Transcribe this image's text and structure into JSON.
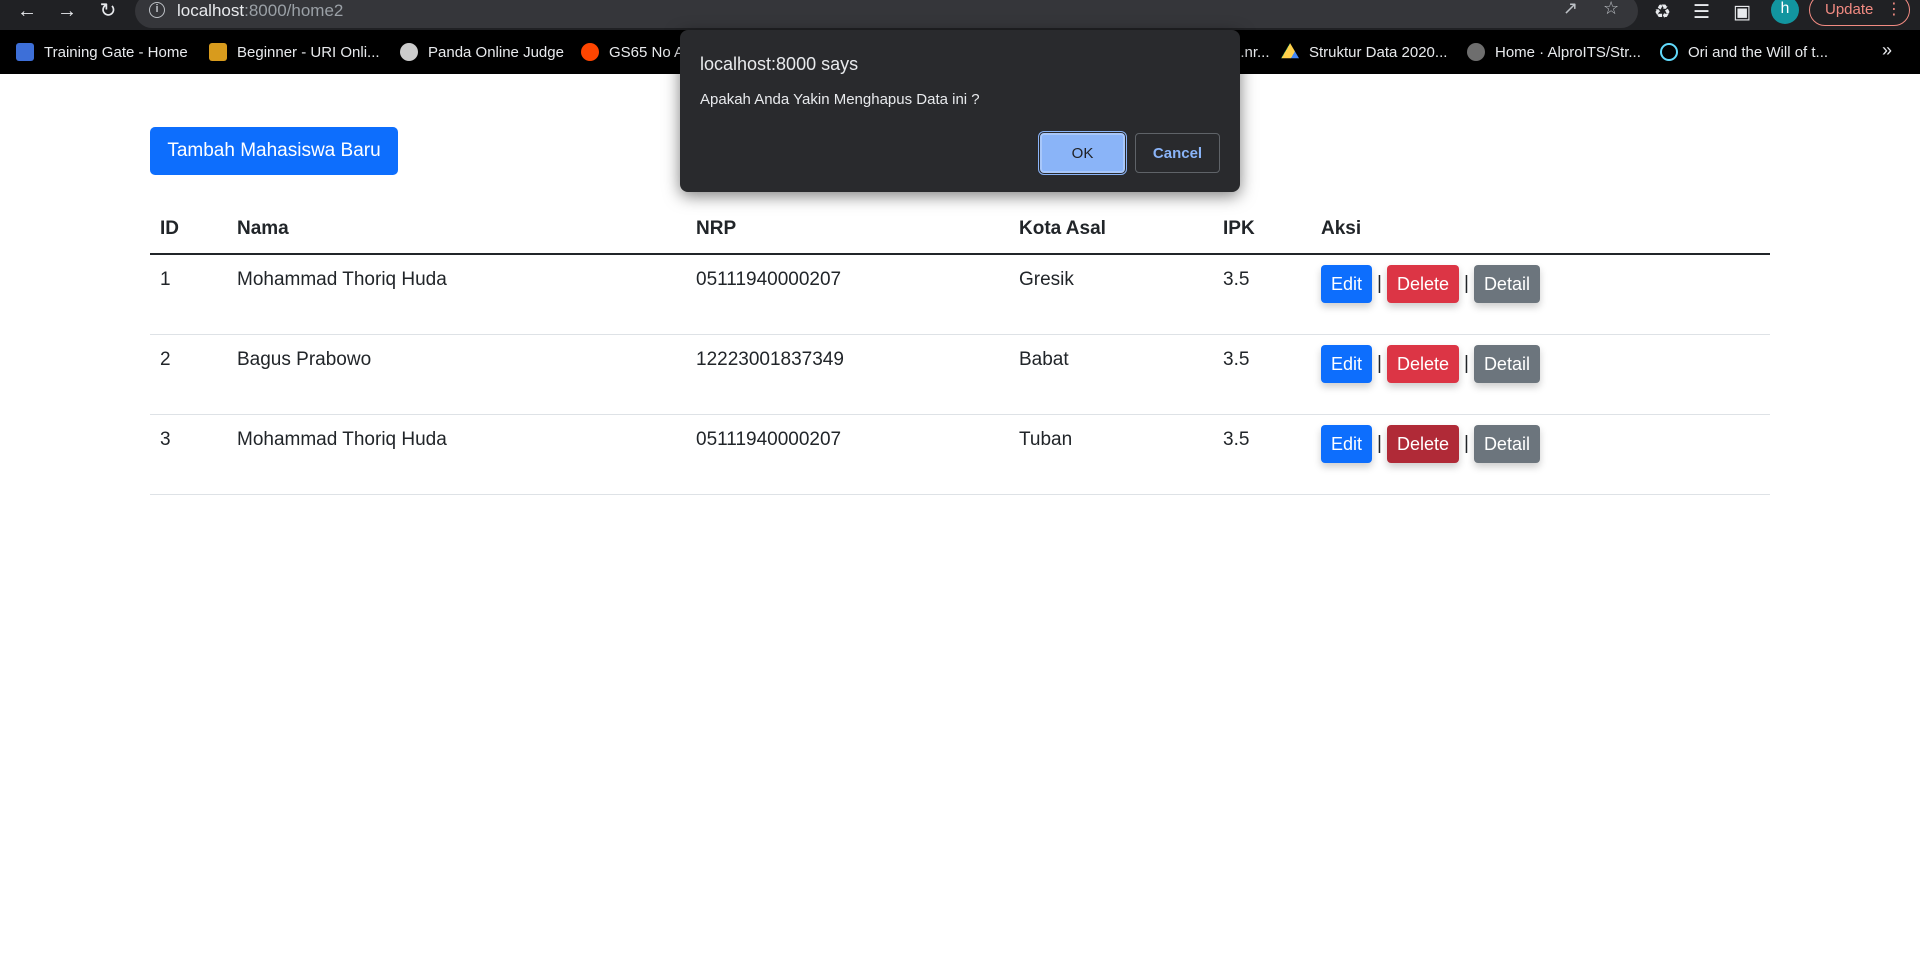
{
  "browser": {
    "url_host": "localhost",
    "url_path": ":8000/home2",
    "update_label": "Update",
    "avatar_letter": "h",
    "bookmarks": [
      {
        "label": "Training Gate - Home",
        "icon": "training-gate-icon",
        "color": "#3d6fd8"
      },
      {
        "label": "Beginner - URI Onli...",
        "icon": "trophy-icon",
        "color": "#d89b1d"
      },
      {
        "label": "Panda Online Judge",
        "icon": "panda-icon",
        "color": "#cccccc"
      },
      {
        "label": "GS65 No A",
        "icon": "reddit-icon",
        "color": "#ff4500"
      },
      {
        "label": "...nr...",
        "icon": "generic-icon",
        "color": "#555555"
      },
      {
        "label": "Struktur Data 2020...",
        "icon": "google-drive-icon",
        "color": "#1fa463"
      },
      {
        "label": "Home · AlproITS/Str...",
        "icon": "github-icon",
        "color": "#6e6e6e"
      },
      {
        "label": "Ori and the Will of t...",
        "icon": "react-icon",
        "color": "#61dafb"
      }
    ],
    "more_label": "»"
  },
  "page": {
    "add_button_label": "Tambah Mahasiswa Baru",
    "table": {
      "headers": [
        "ID",
        "Nama",
        "NRP",
        "Kota Asal",
        "IPK",
        "Aksi"
      ],
      "rows": [
        {
          "id": "1",
          "nama": "Mohammad Thoriq Huda",
          "nrp": "05111940000207",
          "kota": "Gresik",
          "ipk": "3.5"
        },
        {
          "id": "2",
          "nama": "Bagus Prabowo",
          "nrp": "12223001837349",
          "kota": "Babat",
          "ipk": "3.5"
        },
        {
          "id": "3",
          "nama": "Mohammad Thoriq Huda",
          "nrp": "05111940000207",
          "kota": "Tuban",
          "ipk": "3.5"
        }
      ],
      "actions": {
        "edit": "Edit",
        "delete": "Delete",
        "detail": "Detail",
        "separator": "|"
      }
    }
  },
  "dialog": {
    "title": "localhost:8000 says",
    "message": "Apakah Anda Yakin Menghapus Data ini ?",
    "ok_label": "OK",
    "cancel_label": "Cancel"
  }
}
